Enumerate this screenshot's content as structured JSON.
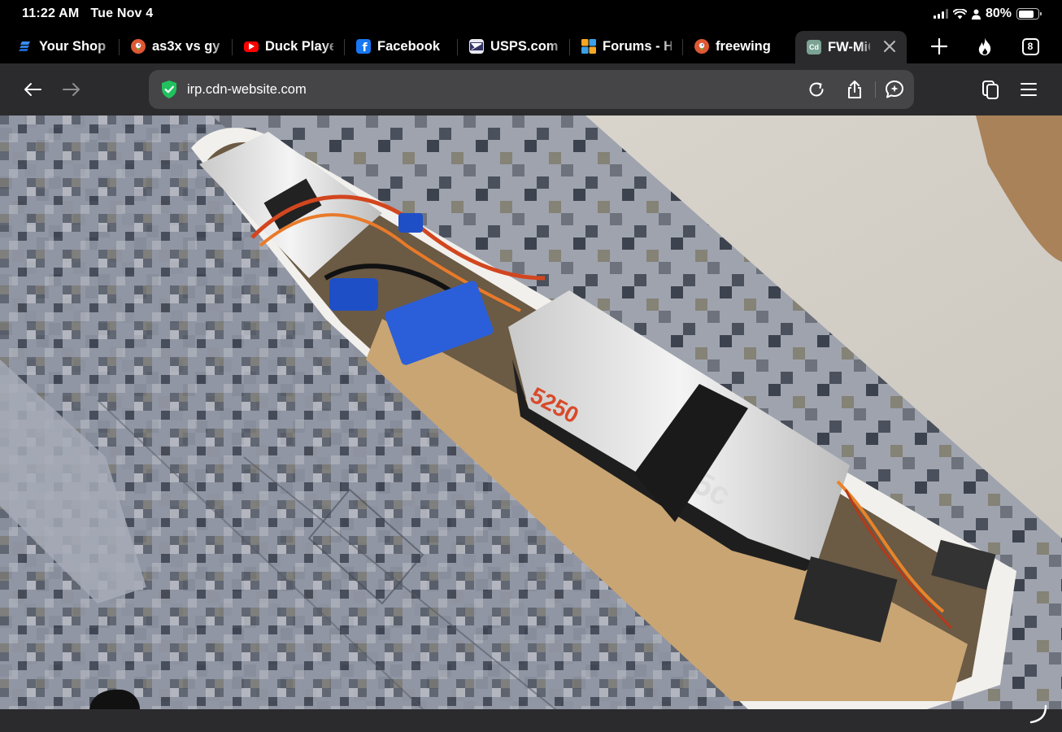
{
  "status": {
    "time": "11:22 AM",
    "date": "Tue Nov 4",
    "battery": "80%",
    "battery_level": 0.8
  },
  "tabs": [
    {
      "label": "Your Shop",
      "favicon": "shop-favicon",
      "color": "#2f7fe0"
    },
    {
      "label": "as3x vs gy",
      "favicon": "duckduckgo-favicon",
      "color": "#de5833"
    },
    {
      "label": "Duck Player",
      "favicon": "youtube-favicon",
      "color": "#ff0000"
    },
    {
      "label": "Facebook",
      "favicon": "facebook-favicon",
      "color": "#1877f2"
    },
    {
      "label": "USPS.com",
      "favicon": "usps-favicon",
      "color": "#333366"
    },
    {
      "label": "Forums - H",
      "favicon": "forums-favicon",
      "color": "#f5a623"
    },
    {
      "label": "freewing",
      "favicon": "duckduckgo-favicon",
      "color": "#de5833"
    },
    {
      "label": "FW-MiG",
      "favicon": "cd-favicon",
      "color": "#6b9080",
      "active": true
    }
  ],
  "tab_strip": {
    "new_tab_icon": "plus-icon",
    "fire_icon": "fire-icon",
    "tab_count": "8"
  },
  "toolbar": {
    "url": "irp.cdn-website.com",
    "back_icon": "back-arrow-icon",
    "forward_icon": "forward-arrow-icon",
    "shield_color": "#21c25e"
  },
  "colors": {
    "chrome_bg": "#000000",
    "toolbar_bg": "#2b2b2d",
    "urlbar_bg": "#454547"
  }
}
